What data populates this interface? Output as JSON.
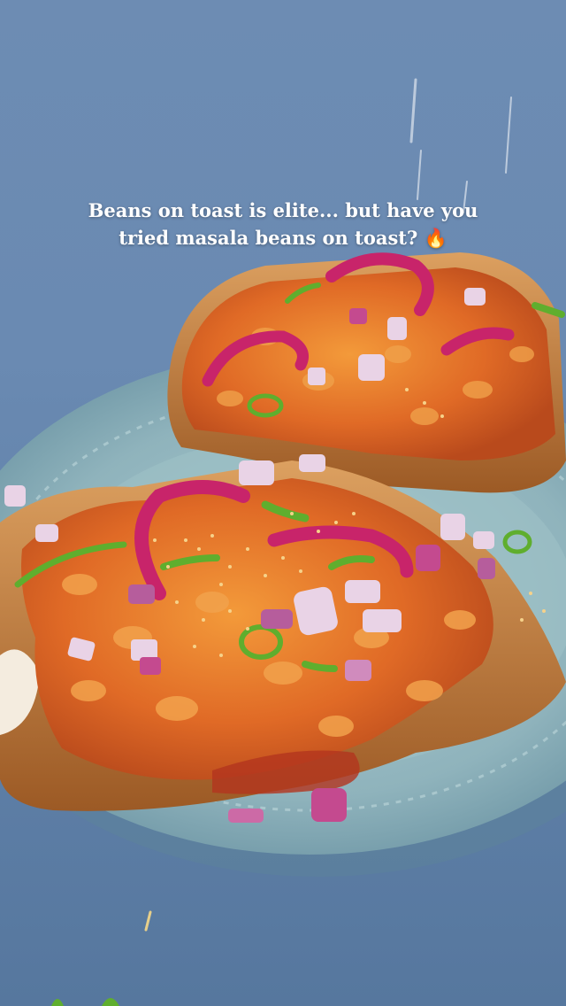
{
  "caption": {
    "line1": "Beans on toast is elite... but have you",
    "line2": "tried masala beans on toast?",
    "emoji": "🔥"
  },
  "colors": {
    "background": "#6a8ab2",
    "plate": "#8fb5bd",
    "toast": "#c9863f",
    "beans": "#e0672a",
    "onion": "#c8246a"
  },
  "scene_items": [
    "photo-background",
    "plate",
    "back-toast",
    "front-toast",
    "beans-topping",
    "pickled-onion",
    "chopped-onion",
    "green-chilli",
    "grated-cheese"
  ]
}
